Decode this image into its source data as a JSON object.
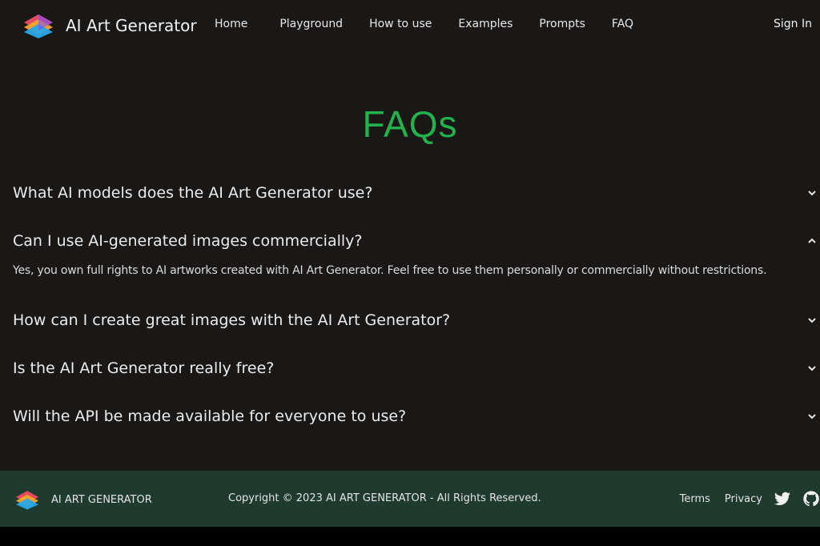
{
  "header": {
    "brand_name": "AI Art Generator",
    "nav": [
      "Home",
      "Playground",
      "How to use",
      "Examples",
      "Prompts",
      "FAQ"
    ],
    "sign_in": "Sign In"
  },
  "main": {
    "title": "FAQs",
    "faqs": [
      {
        "question": "What AI models does the AI Art Generator use?",
        "expanded": false,
        "answer": ""
      },
      {
        "question": "Can I use AI-generated images commercially?",
        "expanded": true,
        "answer": "Yes, you own full rights to AI artworks created with AI Art Generator. Feel free to use them personally or commercially without restrictions."
      },
      {
        "question": "How can I create great images with the AI Art Generator?",
        "expanded": false,
        "answer": ""
      },
      {
        "question": "Is the AI Art Generator really free?",
        "expanded": false,
        "answer": ""
      },
      {
        "question": "Will the API be made available for everyone to use?",
        "expanded": false,
        "answer": ""
      }
    ]
  },
  "footer": {
    "brand_name": "AI ART GENERATOR",
    "copyright": "Copyright © 2023 AI ART GENERATOR - All Rights Reserved.",
    "links": [
      "Terms",
      "Privacy"
    ],
    "social_icons": [
      "twitter-icon",
      "github-icon"
    ]
  },
  "colors": {
    "background": "#1a1717",
    "accent": "#22b14c",
    "footer_bg": "#1f3a2f"
  }
}
